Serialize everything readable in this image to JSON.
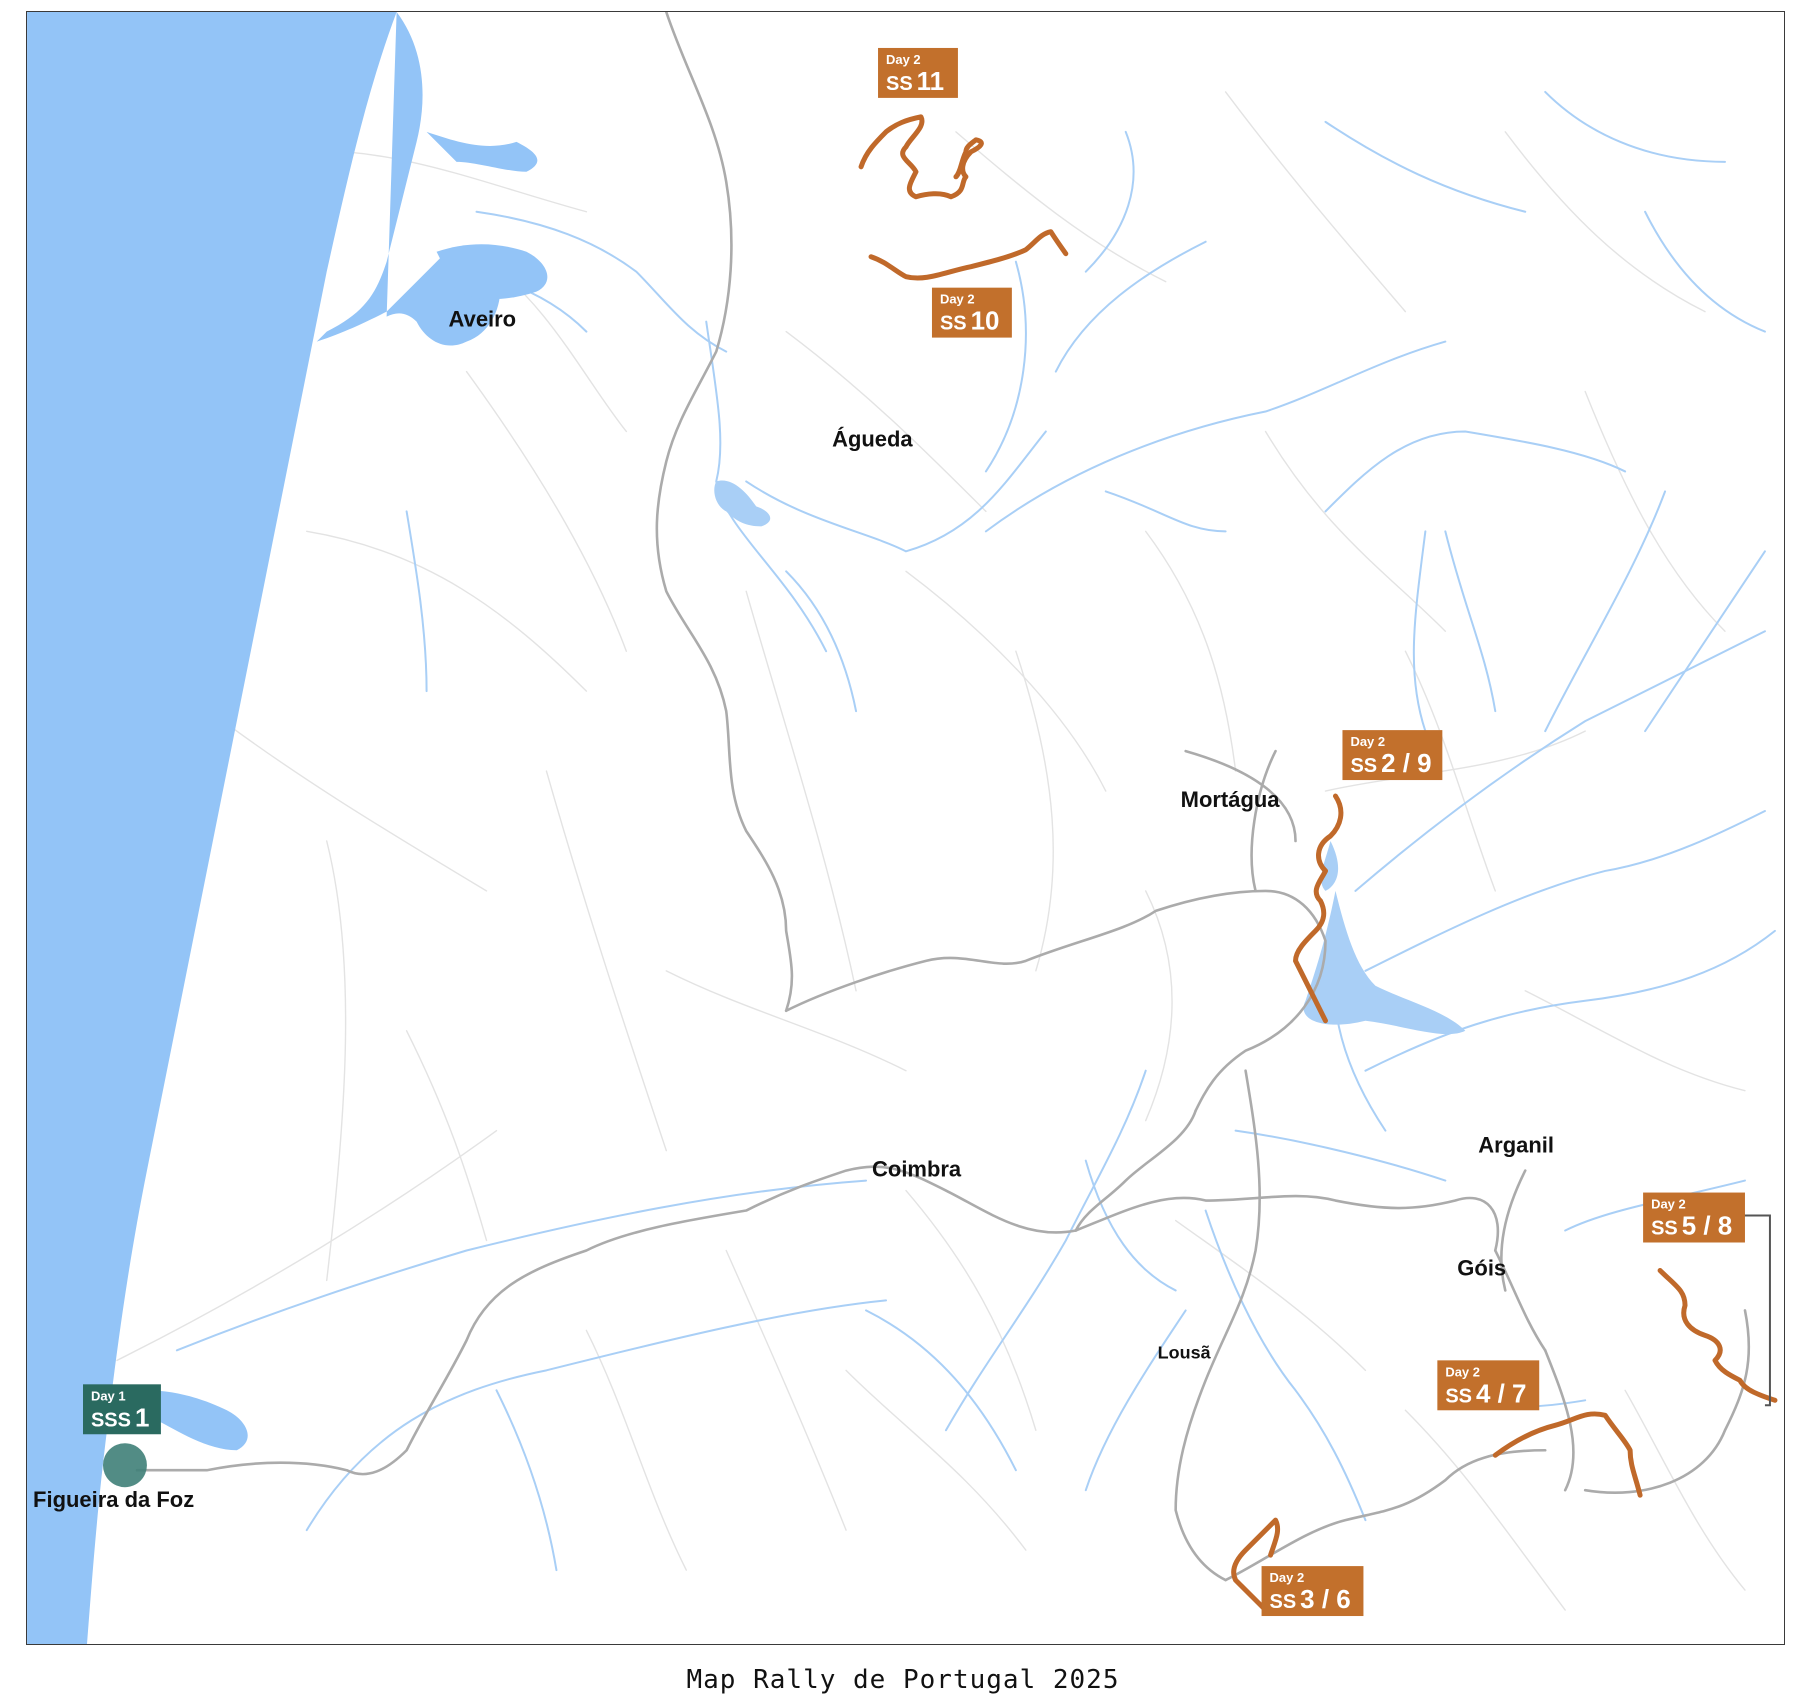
{
  "caption": "Map Rally de Portugal 2025",
  "colors": {
    "sea": "#93c4f7",
    "river": "#a9cff6",
    "main_road": "#ababab",
    "minor_road": "#e3e3e3",
    "stage_route": "#c0692a",
    "day1_label": "#2a6a60",
    "day1_marker": "#3f7f78",
    "day2_label": "#c2702c",
    "town_text": "#111111"
  },
  "towns": [
    {
      "id": "aveiro",
      "name": "Aveiro"
    },
    {
      "id": "agueda",
      "name": "Águeda"
    },
    {
      "id": "mortagua",
      "name": "Mortágua"
    },
    {
      "id": "coimbra",
      "name": "Coimbra"
    },
    {
      "id": "arganil",
      "name": "Arganil"
    },
    {
      "id": "gois",
      "name": "Góis"
    },
    {
      "id": "lousa",
      "name": "Lousã"
    },
    {
      "id": "figueira",
      "name": "Figueira da Foz"
    }
  ],
  "stages": [
    {
      "id": "sss1",
      "day": "Day 1",
      "prefix": "SSS",
      "number": "1"
    },
    {
      "id": "ss11",
      "day": "Day 2",
      "prefix": "SS",
      "number": "11"
    },
    {
      "id": "ss10",
      "day": "Day 2",
      "prefix": "SS",
      "number": "10"
    },
    {
      "id": "ss2-9",
      "day": "Day 2",
      "prefix": "SS",
      "number": "2 / 9"
    },
    {
      "id": "ss5-8",
      "day": "Day 2",
      "prefix": "SS",
      "number": "5 / 8"
    },
    {
      "id": "ss4-7",
      "day": "Day 2",
      "prefix": "SS",
      "number": "4 / 7"
    },
    {
      "id": "ss3-6",
      "day": "Day 2",
      "prefix": "SS",
      "number": "3 / 6"
    }
  ]
}
